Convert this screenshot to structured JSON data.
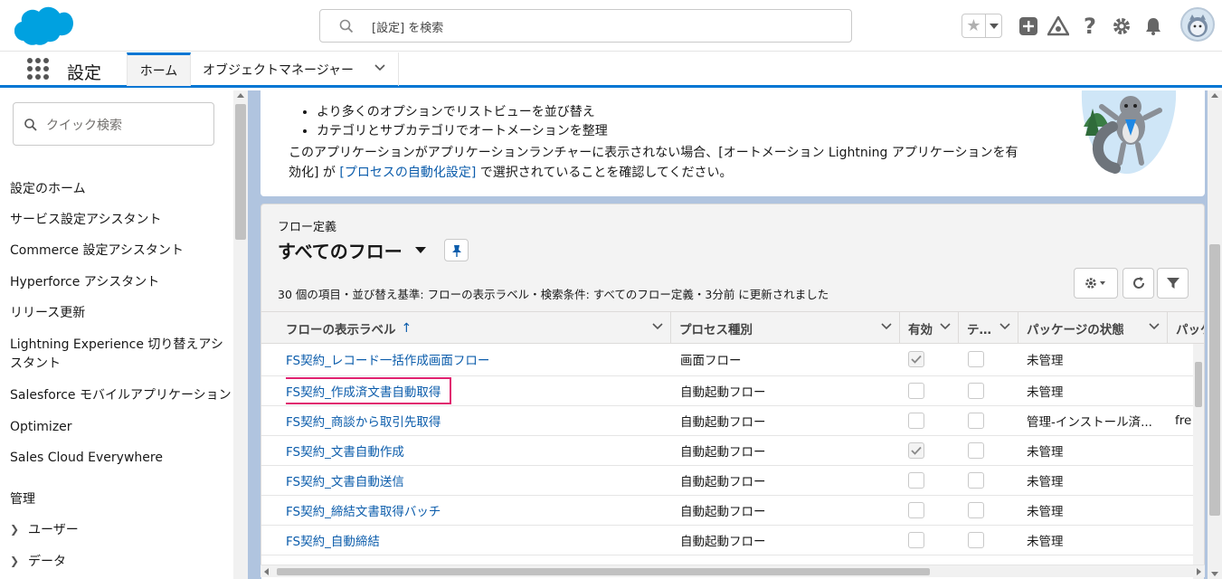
{
  "header": {
    "search_placeholder": "[設定] を検索",
    "icons": [
      "favorites-star-icon",
      "favorites-dropdown-icon",
      "add-icon",
      "trailhead-icon",
      "help-icon",
      "setup-gear-icon",
      "notifications-bell-icon",
      "user-avatar"
    ]
  },
  "context": {
    "app_name": "設定",
    "tabs": [
      {
        "label": "ホーム",
        "active": true
      },
      {
        "label": "オブジェクトマネージャー",
        "active": false
      }
    ]
  },
  "sidebar": {
    "quick_search_placeholder": "クイック検索",
    "items": [
      "設定のホーム",
      "サービス設定アシスタント",
      "Commerce 設定アシスタント",
      "Hyperforce アシスタント",
      "リリース更新",
      "Lightning Experience 切り替えアシスタント",
      "Salesforce モバイルアプリケーション",
      "Optimizer",
      "Sales Cloud Everywhere"
    ],
    "section_title": "管理",
    "tree": [
      "ユーザー",
      "データ"
    ]
  },
  "intro_card": {
    "bullets": [
      "より多くのオプションでリストビューを並び替え",
      "カテゴリとサブカテゴリでオートメーションを整理"
    ],
    "text_before": "このアプリケーションがアプリケーションランチャーに表示されない場合、[オートメーション Lightning アプリケーションを有効化] が ",
    "link": "[プロセスの自動化設定]",
    "text_after": " で選択されていることを確認してください。"
  },
  "list_view": {
    "object_label": "フロー定義",
    "title": "すべてのフロー",
    "info": "30 個の項目・並び替え基準: フローの表示ラベル・検索条件: すべてのフロー定義・3分前 に更新されました",
    "columns": [
      "フローの表示ラベル",
      "プロセス種別",
      "有効",
      "テ…",
      "パッケージの状態",
      "パッケ"
    ],
    "rows": [
      {
        "label": "FS契約_レコード一括作成画面フロー",
        "type": "画面フロー",
        "active": true,
        "test": false,
        "package": "未管理",
        "extra": ""
      },
      {
        "label": "FS契約_作成済文書自動取得",
        "type": "自動起動フロー",
        "active": false,
        "test": false,
        "package": "未管理",
        "extra": "",
        "highlighted": true
      },
      {
        "label": "FS契約_商談から取引先取得",
        "type": "自動起動フロー",
        "active": false,
        "test": false,
        "package": "管理-インストール済...",
        "extra": "fre"
      },
      {
        "label": "FS契約_文書自動作成",
        "type": "自動起動フロー",
        "active": true,
        "test": false,
        "package": "未管理",
        "extra": ""
      },
      {
        "label": "FS契約_文書自動送信",
        "type": "自動起動フロー",
        "active": false,
        "test": false,
        "package": "未管理",
        "extra": ""
      },
      {
        "label": "FS契約_締結文書取得バッチ",
        "type": "自動起動フロー",
        "active": false,
        "test": false,
        "package": "未管理",
        "extra": ""
      },
      {
        "label": "FS契約_自動締結",
        "type": "自動起動フロー",
        "active": false,
        "test": false,
        "package": "未管理",
        "extra": ""
      }
    ]
  },
  "colors": {
    "brand_blue": "#0176d3",
    "link": "#0b5cab",
    "highlight": "#e0216f",
    "page_bg": "#b0c4df"
  }
}
